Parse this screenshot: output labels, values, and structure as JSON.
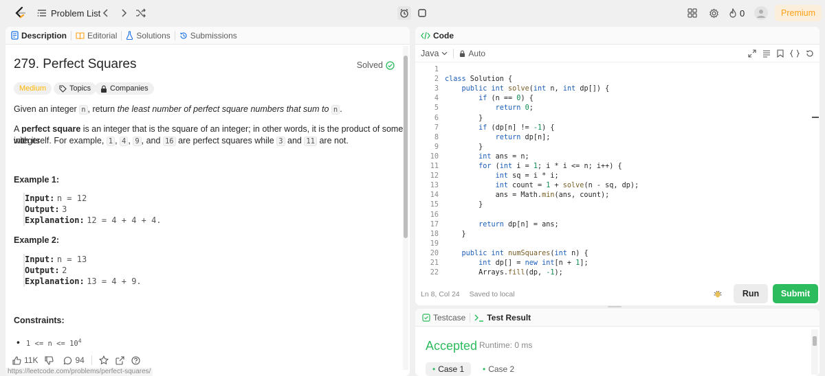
{
  "topbar": {
    "problem_list": "Problem List",
    "premium": "Premium",
    "streak": "0"
  },
  "left_tabs": {
    "description": "Description",
    "editorial": "Editorial",
    "solutions": "Solutions",
    "submissions": "Submissions"
  },
  "problem": {
    "title": "279. Perfect Squares",
    "solved": "Solved",
    "difficulty": "Medium",
    "topics": "Topics",
    "companies": "Companies",
    "p1_pre": "Given an integer ",
    "p1_code": "n",
    "p1_mid": ", return ",
    "p1_em": "the least number of perfect square numbers that sum to",
    "p1_code2": "n",
    "p1_end": ".",
    "p2_pre": "A ",
    "p2_bold": "perfect square",
    "p2_rest": " is an integer that is the square of an integer; in other words, it is the product of some integer",
    "p3_pre": "with itself. For example, ",
    "p3_c1": "1",
    "p3_c2": "4",
    "p3_c3": "9",
    "p3_and": ", and ",
    "p3_c4": "16",
    "p3_mid": " are perfect squares while ",
    "p3_c5": "3",
    "p3_and2": " and ",
    "p3_c6": "11",
    "p3_end": " are not.",
    "example1": "Example 1:",
    "ex1_input_label": "Input:",
    "ex1_input": "n = 12",
    "ex1_output_label": "Output:",
    "ex1_output": "3",
    "ex1_expl_label": "Explanation:",
    "ex1_expl": "12 = 4 + 4 + 4.",
    "example2": "Example 2:",
    "ex2_input_label": "Input:",
    "ex2_input": "n = 13",
    "ex2_output_label": "Output:",
    "ex2_output": "2",
    "ex2_expl_label": "Explanation:",
    "ex2_expl": "13 = 4 + 9.",
    "constraints": "Constraints:",
    "constraint1_a": "1 <= n <= 10",
    "constraint1_sup": "4"
  },
  "footer": {
    "likes": "11K",
    "comments": "94",
    "url": "https://leetcode.com/problems/perfect-squares/"
  },
  "code_panel": {
    "title": "Code",
    "language": "Java",
    "auto": "Auto",
    "status_pos": "Ln 8, Col 24",
    "status_saved": "Saved to local",
    "run": "Run",
    "submit": "Submit",
    "lines": [
      {
        "n": "1",
        "t": ""
      },
      {
        "n": "2",
        "t": "class Solution {"
      },
      {
        "n": "3",
        "t": "    public int solve(int n, int dp[]) {"
      },
      {
        "n": "4",
        "t": "        if (n == 0) {"
      },
      {
        "n": "5",
        "t": "            return 0;"
      },
      {
        "n": "6",
        "t": "        }"
      },
      {
        "n": "7",
        "t": "        if (dp[n] != -1) {"
      },
      {
        "n": "8",
        "t": "            return dp[n];"
      },
      {
        "n": "9",
        "t": "        }"
      },
      {
        "n": "10",
        "t": "        int ans = n;"
      },
      {
        "n": "11",
        "t": "        for (int i = 1; i * i <= n; i++) {"
      },
      {
        "n": "12",
        "t": "            int sq = i * i;"
      },
      {
        "n": "13",
        "t": "            int count = 1 + solve(n - sq, dp);"
      },
      {
        "n": "14",
        "t": "            ans = Math.min(ans, count);"
      },
      {
        "n": "15",
        "t": "        }"
      },
      {
        "n": "16",
        "t": ""
      },
      {
        "n": "17",
        "t": "        return dp[n] = ans;"
      },
      {
        "n": "18",
        "t": "    }"
      },
      {
        "n": "19",
        "t": ""
      },
      {
        "n": "20",
        "t": "    public int numSquares(int n) {"
      },
      {
        "n": "21",
        "t": "        int dp[] = new int[n + 1];"
      },
      {
        "n": "22",
        "t": "        Arrays.fill(dp, -1);"
      }
    ]
  },
  "result_panel": {
    "testcase": "Testcase",
    "test_result": "Test Result",
    "accepted": "Accepted",
    "runtime": "Runtime: 0 ms",
    "case1": "Case 1",
    "case2": "Case 2"
  },
  "colors": {
    "accent_green": "#2cbb5d",
    "premium_orange": "#ffa116",
    "medium_orange": "#ffb800"
  }
}
